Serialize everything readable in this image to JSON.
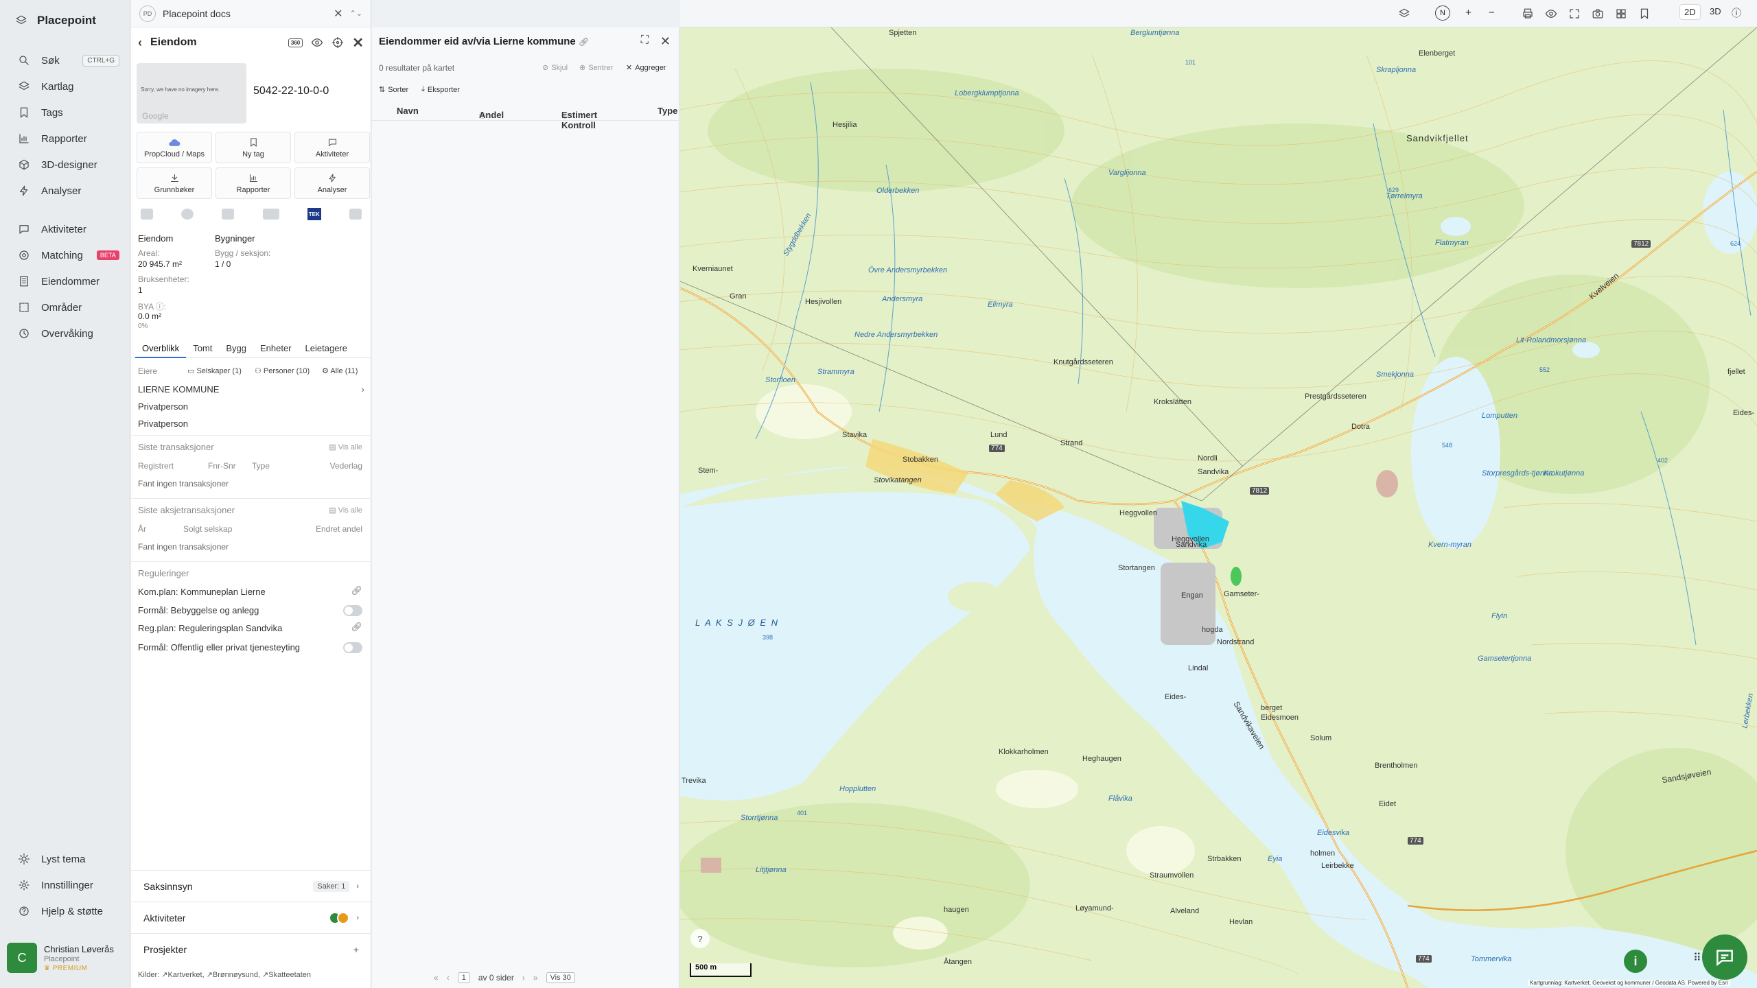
{
  "app": {
    "name": "Placepoint"
  },
  "sidebar": {
    "search": {
      "label": "Søk",
      "shortcut": "CTRL+G"
    },
    "items": [
      {
        "label": "Kartlag"
      },
      {
        "label": "Tags"
      },
      {
        "label": "Rapporter"
      },
      {
        "label": "3D-designer"
      },
      {
        "label": "Analyser"
      },
      {
        "label": "Aktiviteter"
      },
      {
        "label": "Matching",
        "badge": "BETA"
      },
      {
        "label": "Eiendommer"
      },
      {
        "label": "Områder"
      },
      {
        "label": "Overvåking"
      }
    ],
    "bottom": [
      {
        "label": "Lyst tema"
      },
      {
        "label": "Innstillinger"
      },
      {
        "label": "Hjelp & støtte"
      }
    ],
    "user": {
      "initial": "C",
      "name": "Christian Løverås",
      "org": "Placepoint",
      "plan": "PREMIUM"
    }
  },
  "docs": {
    "badge": "PD",
    "title": "Placepoint docs"
  },
  "property": {
    "title": "Eiendom",
    "badge_360": "360",
    "image_text": "Sorry, we have no imagery here.",
    "image_credit": "Google",
    "id": "5042-22-10-0-0",
    "actions": [
      {
        "label": "PropCloud / Maps"
      },
      {
        "label": "Ny tag"
      },
      {
        "label": "Aktiviteter"
      },
      {
        "label": "Grunnbøker"
      },
      {
        "label": "Rapporter"
      },
      {
        "label": "Analyser"
      }
    ],
    "tek_label": "TEK",
    "info": {
      "eiendom_heading": "Eiendom",
      "bygninger_heading": "Bygninger",
      "areal_label": "Areal:",
      "areal_value": "20 945.7 m²",
      "bygg_label": "Bygg / seksjon:",
      "bygg_value": "1 / 0",
      "bruks_label": "Bruksenheter:",
      "bruks_value": "1",
      "bya_label": "BYA ⓘ:",
      "bya_value": "0.0 m²",
      "bya_pct": "0%"
    },
    "tabs": [
      "Overblikk",
      "Tomt",
      "Bygg",
      "Enheter",
      "Leietagere"
    ],
    "owners": {
      "label": "Eiere",
      "selskaper": "Selskaper (1)",
      "personer": "Personer (10)",
      "alle": "Alle (11)",
      "list": [
        "LIERNE KOMMUNE",
        "Privatperson",
        "Privatperson"
      ]
    },
    "transactions": {
      "label": "Siste transaksjoner",
      "vis_alle": "Vis alle",
      "cols": [
        "Registrert",
        "Fnr-Snr",
        "Type",
        "Vederlag"
      ],
      "empty": "Fant ingen transaksjoner"
    },
    "share_transactions": {
      "label": "Siste aksjetransaksjoner",
      "vis_alle": "Vis alle",
      "cols": [
        "År",
        "Solgt selskap",
        "Endret andel"
      ],
      "empty": "Fant ingen transaksjoner"
    },
    "regulations": {
      "label": "Reguleringer",
      "items": [
        "Kom.plan: Kommuneplan Lierne",
        "Formål: Bebyggelse og anlegg",
        "Reg.plan: Reguleringsplan Sandvika",
        "Formål: Offentlig eller privat tjenesteyting"
      ]
    },
    "folds": [
      {
        "label": "Saksinnsyn",
        "extra": "Saker: 1"
      },
      {
        "label": "Aktiviteter",
        "extra": ""
      },
      {
        "label": "Prosjekter",
        "extra": "+"
      }
    ],
    "sources": "Kilder: ↗Kartverket, ↗Brønnøysund, ↗Skatteetaten"
  },
  "results": {
    "title": "Eiendommer eid av/via Lierne kommune",
    "count": "0 resultater på kartet",
    "tools": [
      "Skjul",
      "Sentrer",
      "Aggreger"
    ],
    "sort": "Sorter",
    "export": "Eksporter",
    "columns": [
      "Navn",
      "Andel",
      "Estimert Kontroll",
      "Type"
    ],
    "pager": {
      "page": "1",
      "of": "av 0 sider",
      "per_page": "Vis 30"
    }
  },
  "map_toolbar": {
    "compass": "N",
    "plus": "+",
    "minus": "−",
    "mode_2d": "2D",
    "mode_3d": "3D"
  },
  "map": {
    "lake": "L A K S J Ø E N",
    "lake_elev": "398",
    "places": [
      "Spjetten",
      "Elenberget",
      "Hesjilia",
      "Sandvikfjellet",
      "Olderbekken",
      "Kverniaunet",
      "Gran",
      "Hesjivollen",
      "Knutgårdsseteren",
      "Krokslätten",
      "Prestgårdsseteren",
      "Dotra",
      "Lund",
      "Strand",
      "Stobakken",
      "Stavika",
      "Nordli",
      "Sandvika",
      "Heggvollen",
      "Stortangen",
      "Engan",
      "Gamseter-",
      "hogda",
      "Nordstrand",
      "Lindal",
      "Eides-",
      "berget",
      "Eidesmoen",
      "Solum",
      "Brentholmen",
      "Klokkarholmen",
      "Heghaugen",
      "Trevika",
      "Eidet",
      "Strbakken",
      "Straumvollen",
      "Alveland",
      "Hevlan",
      "Løyamund-",
      "haugen",
      "Åtangen",
      "Stem-",
      "fjellet",
      "Eides-",
      "holmen",
      "Leirbekke"
    ],
    "waters": [
      "Berglumtjønna",
      "Skrapljonna",
      "Varglijonna",
      "Tørrelmyra",
      "Flatmyran",
      "Stygddbekken",
      "Övre Andersmyrbekken",
      "Andersmyra",
      "Nedre Andersmyrbekken",
      "Elimyra",
      "Strammyra",
      "Storfloen",
      "Stovikatangen",
      "Lomputten",
      "Storpresgårds-tjønna",
      "Krokutjønna",
      "Kvern-myran",
      "Flyin",
      "Gamsetertjonna",
      "Lit-Rolandmorsjønna",
      "Smekjonna",
      "Hopplutten",
      "Storrtjønna",
      "Litjtjønna",
      "Flåvika",
      "Eidesvika",
      "Eyia",
      "Tommervika",
      "Sandsjøveien",
      "Lerbekken",
      "Sandvikaveien",
      "Kvelveien",
      "Lobergklumptjonna"
    ],
    "elev": [
      "629",
      "548",
      "552",
      "624",
      "402",
      "401",
      "101"
    ],
    "roads": [
      "774",
      "7812",
      "774",
      "7812",
      "774"
    ],
    "scale": "500 m",
    "info": "i",
    "attribution": "Kartgrunnlag: Kartverket, Geovekst og kommuner / Geodata AS. Powered by Esri"
  },
  "colors": {
    "accent": "#2d6fd3",
    "brand_green": "#2e8b3d",
    "water": "#dff3fb",
    "land": "#e3efc9",
    "beta": "#e8416b"
  }
}
